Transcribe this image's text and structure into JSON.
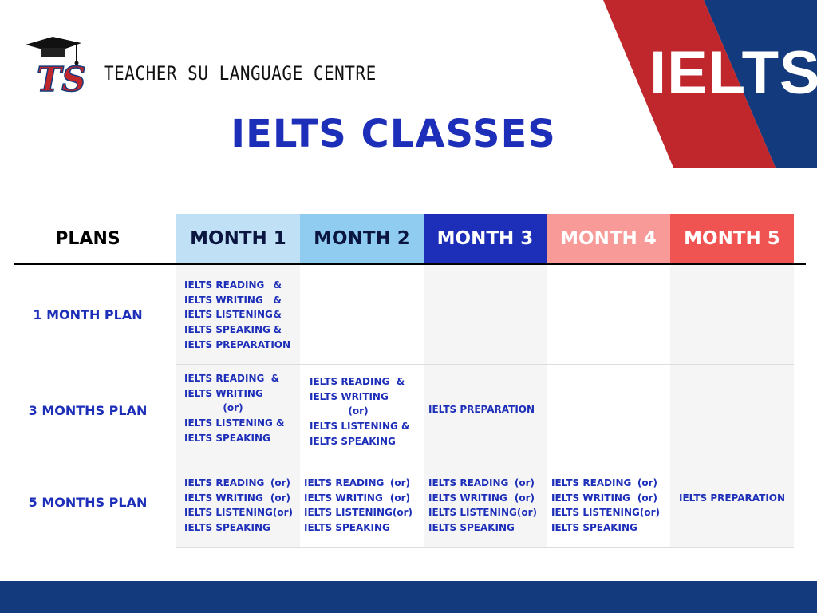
{
  "header": {
    "brand": "TEACHER SU LANGUAGE CENTRE",
    "logo_text": "TS",
    "corner_text": "IELTS",
    "title": "IELTS CLASSES"
  },
  "colors": {
    "title_blue": "#1d2fb8",
    "red": "#c0272d",
    "navy": "#133a7c"
  },
  "table": {
    "plans_header": "PLANS",
    "months": [
      {
        "label": "MONTH 1",
        "bg": "#bfe0f5",
        "fg": "#0a1540"
      },
      {
        "label": "MONTH 2",
        "bg": "#8fccf0",
        "fg": "#0a1540"
      },
      {
        "label": "MONTH 3",
        "bg": "#1d2fb8",
        "fg": "#ffffff"
      },
      {
        "label": "MONTH 4",
        "bg": "#f79a98",
        "fg": "#ffffff"
      },
      {
        "label": "MONTH 5",
        "bg": "#f05452",
        "fg": "#ffffff"
      }
    ],
    "rows": [
      {
        "plan": "1 MONTH PLAN",
        "m1": [
          "IELTS READING",
          "&",
          "IELTS WRITING",
          "&",
          "IELTS LISTENING",
          "&",
          "IELTS SPEAKING",
          "&",
          "IELTS PREPARATION"
        ]
      },
      {
        "plan": "3 MONTHS PLAN",
        "m1": [
          "IELTS READING  &",
          "IELTS WRITING",
          "(or)",
          "IELTS LISTENING &",
          "IELTS SPEAKING"
        ],
        "m2": [
          "IELTS READING  &",
          "IELTS WRITING",
          "(or)",
          "IELTS LISTENING &",
          "IELTS SPEAKING"
        ],
        "m3": "IELTS PREPARATION"
      },
      {
        "plan": "5 MONTHS PLAN",
        "m1": [
          "IELTS READING",
          "(or)",
          "IELTS WRITING",
          "(or)",
          "IELTS LISTENING",
          "(or)",
          "IELTS SPEAKING"
        ],
        "m2": [
          "IELTS READING",
          "(or)",
          "IELTS WRITING",
          "(or)",
          "IELTS LISTENING",
          "(or)",
          "IELTS SPEAKING"
        ],
        "m3": [
          "IELTS READING",
          "(or)",
          "IELTS WRITING",
          "(or)",
          "IELTS LISTENING",
          "(or)",
          "IELTS SPEAKING"
        ],
        "m4": [
          "IELTS READING",
          "(or)",
          "IELTS WRITING",
          "(or)",
          "IELTS LISTENING",
          "(or)",
          "IELTS SPEAKING"
        ],
        "m5": "IELTS PREPARATION"
      }
    ]
  }
}
